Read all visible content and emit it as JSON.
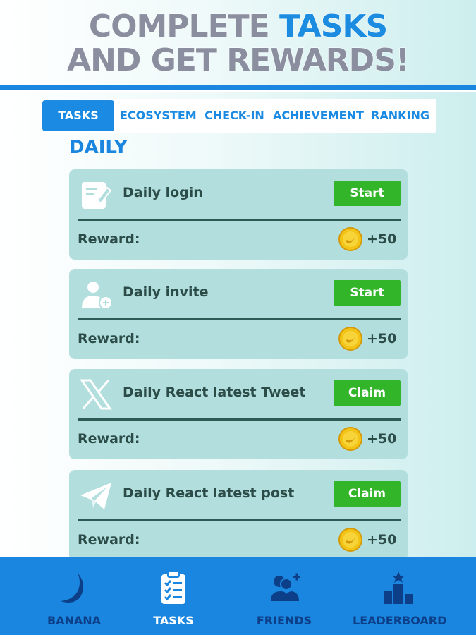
{
  "header": {
    "line1_main": "COMPLETE ",
    "line1_accent": "TASKS",
    "line2": "AND GET REWARDS!"
  },
  "tabs": [
    {
      "label": "TASKS",
      "active": true
    },
    {
      "label": "ECOSYSTEM",
      "active": false
    },
    {
      "label": "CHECK-IN",
      "active": false
    },
    {
      "label": "ACHIEVEMENT",
      "active": false
    },
    {
      "label": "RANKING",
      "active": false
    }
  ],
  "section": {
    "title": "DAILY"
  },
  "tasks": [
    {
      "title": "Daily login",
      "button": "Start",
      "reward_label": "Reward:",
      "reward_value": "+50",
      "icon": "edit-document-icon"
    },
    {
      "title": "Daily invite",
      "button": "Start",
      "reward_label": "Reward:",
      "reward_value": "+50",
      "icon": "add-user-icon"
    },
    {
      "title": "Daily React latest Tweet",
      "button": "Claim",
      "reward_label": "Reward:",
      "reward_value": "+50",
      "icon": "x-logo-icon"
    },
    {
      "title": "Daily React latest post",
      "button": "Claim",
      "reward_label": "Reward:",
      "reward_value": "+50",
      "icon": "telegram-icon"
    }
  ],
  "bottom_nav": [
    {
      "label": "BANANA",
      "icon": "banana-icon",
      "active": false
    },
    {
      "label": "TASKS",
      "icon": "clipboard-icon",
      "active": true
    },
    {
      "label": "FRIENDS",
      "icon": "friends-icon",
      "active": false
    },
    {
      "label": "LEADERBOARD",
      "icon": "podium-icon",
      "active": false
    }
  ],
  "colors": {
    "primary_blue": "#1a86e0",
    "button_green": "#33b52a",
    "card_bg": "#b2dede",
    "coin_gold": "#f3c316",
    "nav_label": "#0c3f87"
  }
}
